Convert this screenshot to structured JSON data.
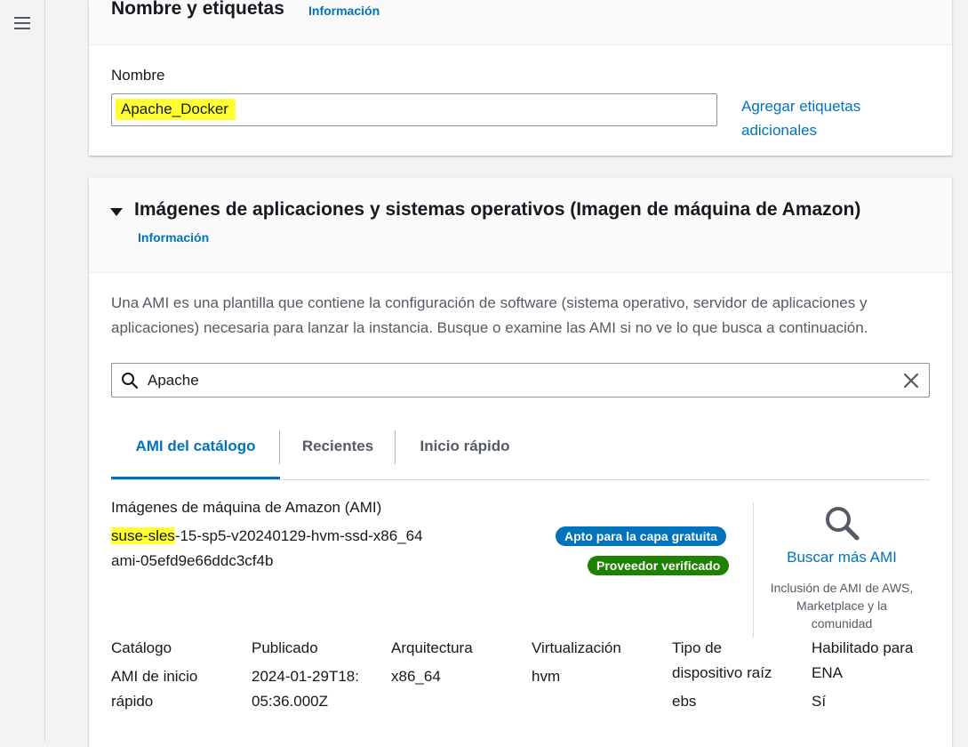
{
  "name_section": {
    "title": "Nombre y etiquetas",
    "info": "Información",
    "field_label": "Nombre",
    "field_value": "Apache_Docker",
    "add_tags": "Agregar etiquetas adicionales"
  },
  "ami_section": {
    "title": "Imágenes de aplicaciones y sistemas operativos (Imagen de máquina de Amazon)",
    "info": "Información",
    "description": "Una AMI es una plantilla que contiene la configuración de software (sistema operativo, servidor de aplicaciones y aplicaciones) necesaria para lanzar la instancia. Busque o examine las AMI si no ve lo que busca a continuación.",
    "search_value": "Apache",
    "tabs": [
      "AMI del catálogo",
      "Recientes",
      "Inicio rápido"
    ],
    "result": {
      "heading": "Imágenes de máquina de Amazon (AMI)",
      "name_highlight": "suse-sles",
      "name_rest": "-15-sp5-v20240129-hvm-ssd-x86_64",
      "ami_id": "ami-05efd9e66ddc3cf4b",
      "badge_free": "Apto para la capa gratuita",
      "badge_verified": "Proveedor verificado",
      "more_link": "Buscar más AMI",
      "more_desc": "Inclusión de AMI de AWS, Marketplace y la comunidad"
    },
    "details": [
      {
        "label": "Catálogo",
        "value": "AMI de inicio rápido"
      },
      {
        "label": "Publicado",
        "value": "2024-01-29T18:05:36.000Z"
      },
      {
        "label": "Arquitectura",
        "value": "x86_64"
      },
      {
        "label": "Virtualización",
        "value": "hvm"
      },
      {
        "label": "Tipo de dispositivo raíz",
        "value": "ebs"
      },
      {
        "label": "Habilitado para ENA",
        "value": "Sí"
      }
    ]
  },
  "colors": {
    "link": "#0073bb",
    "free_badge": "#0073bb",
    "verified_badge": "#1d8102",
    "highlight": "#ffff33"
  },
  "icons": [
    "menu-icon",
    "search-icon",
    "clear-icon",
    "caret-down-icon"
  ]
}
